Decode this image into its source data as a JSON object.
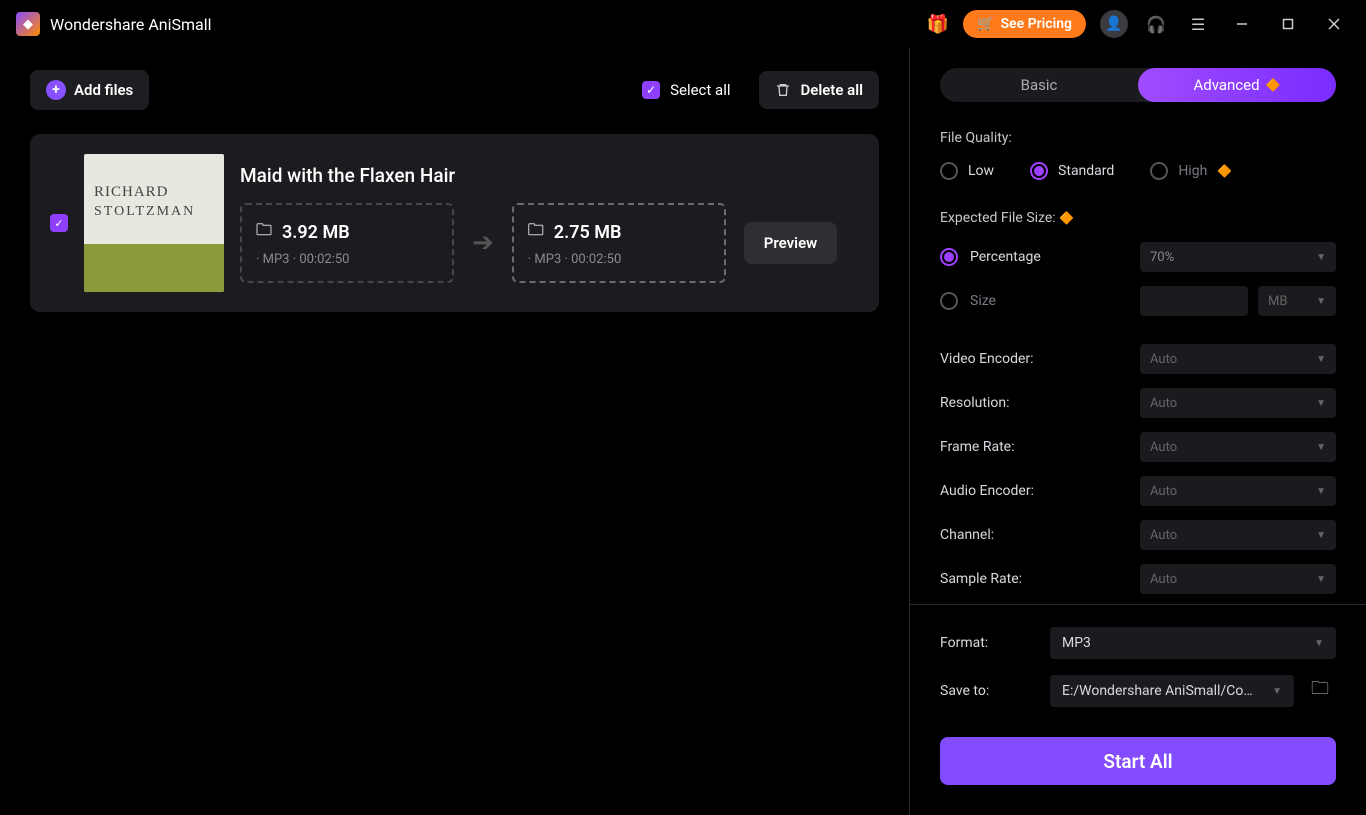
{
  "titlebar": {
    "app_name": "Wondershare AniSmall",
    "see_pricing": "See Pricing"
  },
  "actions": {
    "add_files": "Add files",
    "select_all": "Select all",
    "delete_all": "Delete all"
  },
  "file": {
    "title": "Maid with the Flaxen Hair",
    "thumb_line1": "RICHARD",
    "thumb_line2": "STOLTZMAN",
    "orig_size": "3.92 MB",
    "orig_meta": "· MP3  · 00:02:50",
    "out_size": "2.75 MB",
    "out_meta": "· MP3  · 00:02:50",
    "preview": "Preview"
  },
  "tabs": {
    "basic": "Basic",
    "advanced": "Advanced"
  },
  "panel": {
    "file_quality_label": "File Quality:",
    "quality": {
      "low": "Low",
      "standard": "Standard",
      "high": "High"
    },
    "expected_label": "Expected File Size:",
    "percentage_label": "Percentage",
    "percentage_value": "70%",
    "size_label": "Size",
    "size_unit": "MB",
    "video_encoder": "Video Encoder:",
    "resolution": "Resolution:",
    "frame_rate": "Frame Rate:",
    "audio_encoder": "Audio Encoder:",
    "channel": "Channel:",
    "sample_rate": "Sample Rate:",
    "auto": "Auto"
  },
  "bottom": {
    "format_label": "Format:",
    "format_value": "MP3",
    "save_to_label": "Save to:",
    "save_to_value": "E:/Wondershare AniSmall/Comp",
    "start_all": "Start All"
  }
}
